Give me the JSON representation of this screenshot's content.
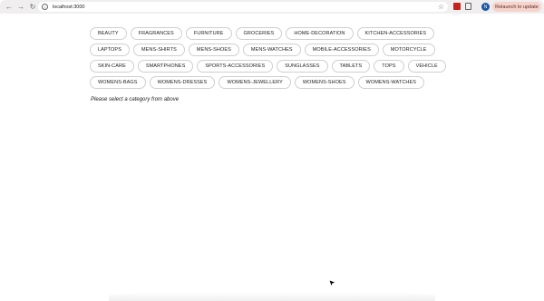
{
  "browser": {
    "url": "localhost:3000",
    "relaunch_label": "Relaunch to update",
    "profile_initial": "N"
  },
  "categories": [
    "BEAUTY",
    "FRAGRANCES",
    "FURNITURE",
    "GROCERIES",
    "HOME-DECORATION",
    "KITCHEN-ACCESSORIES",
    "LAPTOPS",
    "MENS-SHIRTS",
    "MENS-SHOES",
    "MENS-WATCHES",
    "MOBILE-ACCESSORIES",
    "MOTORCYCLE",
    "SKIN-CARE",
    "SMARTPHONES",
    "SPORTS-ACCESSORIES",
    "SUNGLASSES",
    "TABLETS",
    "TOPS",
    "VEHICLE",
    "WOMENS-BAGS",
    "WOMENS-DRESSES",
    "WOMENS-JEWELLERY",
    "WOMENS-SHOES",
    "WOMENS-WATCHES"
  ],
  "prompt": "Please select a category from above",
  "icons": {
    "back": "back-arrow-icon",
    "forward": "forward-arrow-icon",
    "reload": "reload-icon",
    "info": "info-icon",
    "star": "star-icon"
  }
}
